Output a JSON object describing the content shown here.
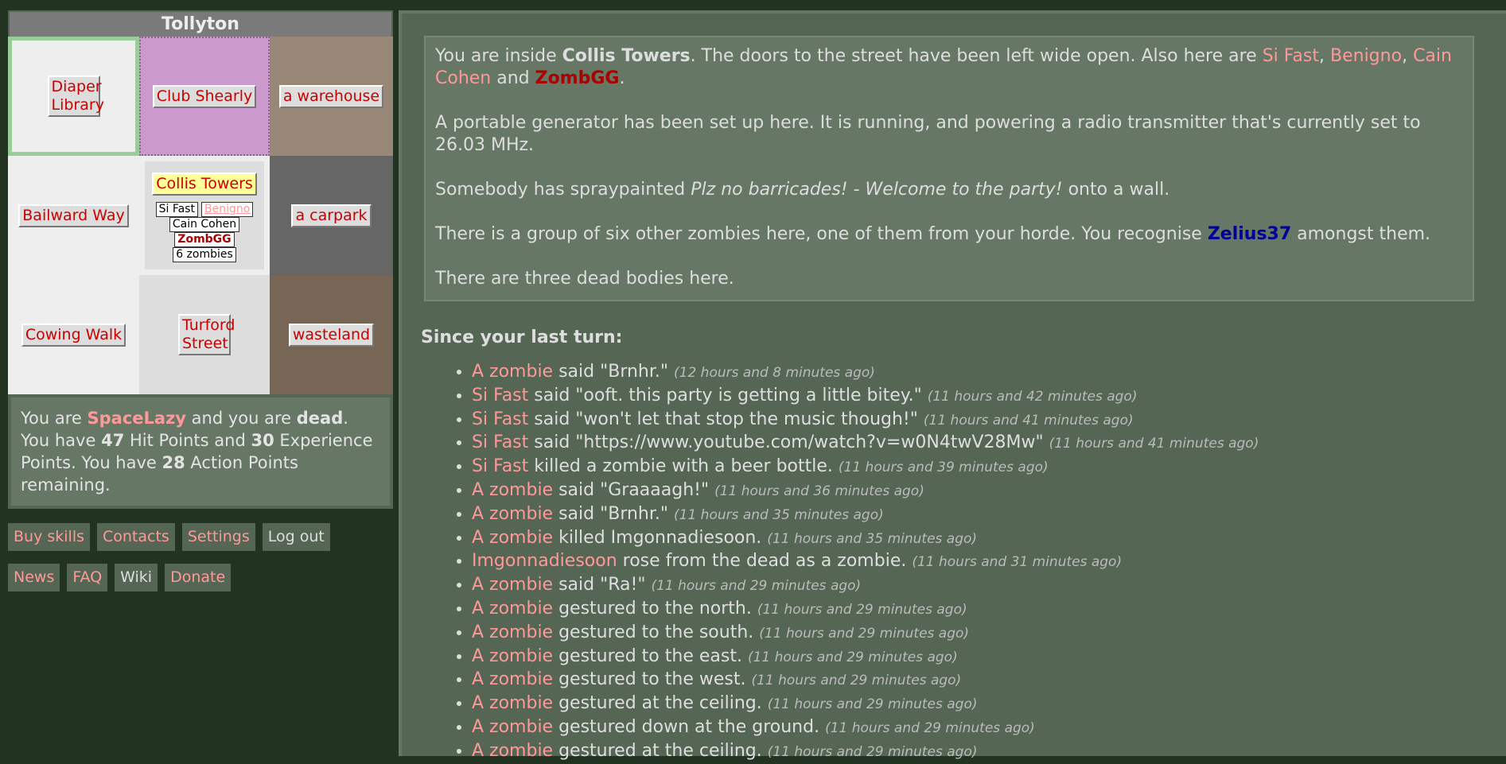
{
  "suburb_name": "Tollyton",
  "map": {
    "cells": [
      {
        "label": "Diaper Library"
      },
      {
        "label": "Club Shearly"
      },
      {
        "label": "a warehouse"
      },
      {
        "label": "Bailward Way"
      },
      {
        "label": "Collis Towers"
      },
      {
        "label": "a carpark"
      },
      {
        "label": "Cowing Walk"
      },
      {
        "label": "Turford Street"
      },
      {
        "label": "wasteland"
      }
    ],
    "occupants": [
      "Si Fast",
      "Benigno",
      "Cain Cohen",
      "ZombGG"
    ],
    "zombie_count": "6 zombies"
  },
  "status": {
    "t1": "You are ",
    "name": "SpaceLazy",
    "t2": " and you are ",
    "state": "dead",
    "t3": ". You have ",
    "hp": "47",
    "t4": " Hit Points and ",
    "xp": "30",
    "t5": " Experience Points. You have ",
    "ap": "28",
    "t6": " Action Points remaining."
  },
  "links_row1": [
    "Buy skills",
    "Contacts",
    "Settings",
    "Log out"
  ],
  "links_row2": [
    "News",
    "FAQ",
    "Wiki",
    "Donate"
  ],
  "description": {
    "p1": {
      "a": "You are inside ",
      "place": "Collis Towers",
      "b": ". The doors to the street have been left wide open. Also here are ",
      "n1": "Si Fast",
      "c": ", ",
      "n2": "Benigno",
      "d": ", ",
      "n3": "Cain Cohen",
      "e": " and ",
      "n4": "ZombGG",
      "f": "."
    },
    "p2": "A portable generator has been set up here. It is running, and powering a radio transmitter that's currently set to 26.03 MHz.",
    "p3": {
      "a": "Somebody has spraypainted ",
      "graffiti": "Plz no barricades! - Welcome to the party!",
      "b": " onto a wall."
    },
    "p4": {
      "a": "There is a group of six other zombies here, one of them from your horde. You recognise ",
      "name": "Zelius37",
      "b": " amongst them."
    },
    "p5": "There are three dead bodies here."
  },
  "since_heading": "Since your last turn:",
  "events": [
    {
      "actor": "A zombie",
      "text": " said \"Brnhr.\" ",
      "ago": "(12 hours and 8 minutes ago)"
    },
    {
      "actor": "Si Fast",
      "text": " said \"ooft. this party is getting a little bitey.\" ",
      "ago": "(11 hours and 42 minutes ago)"
    },
    {
      "actor": "Si Fast",
      "text": " said \"won't let that stop the music though!\" ",
      "ago": "(11 hours and 41 minutes ago)"
    },
    {
      "actor": "Si Fast",
      "text": " said \"https://www.youtube.com/watch?v=w0N4twV28Mw\" ",
      "ago": "(11 hours and 41 minutes ago)"
    },
    {
      "actor": "Si Fast",
      "text": " killed a zombie with a beer bottle. ",
      "ago": "(11 hours and 39 minutes ago)"
    },
    {
      "actor": "A zombie",
      "text": " said \"Graaaagh!\" ",
      "ago": "(11 hours and 36 minutes ago)"
    },
    {
      "actor": "A zombie",
      "text": " said \"Brnhr.\" ",
      "ago": "(11 hours and 35 minutes ago)"
    },
    {
      "actor": "A zombie",
      "text": " killed Imgonnadiesoon. ",
      "ago": "(11 hours and 35 minutes ago)"
    },
    {
      "actor": "Imgonnadiesoon",
      "text": " rose from the dead as a zombie. ",
      "ago": "(11 hours and 31 minutes ago)"
    },
    {
      "actor": "A zombie",
      "text": " said \"Ra!\" ",
      "ago": "(11 hours and 29 minutes ago)"
    },
    {
      "actor": "A zombie",
      "text": " gestured to the north. ",
      "ago": "(11 hours and 29 minutes ago)"
    },
    {
      "actor": "A zombie",
      "text": " gestured to the south. ",
      "ago": "(11 hours and 29 minutes ago)"
    },
    {
      "actor": "A zombie",
      "text": " gestured to the east. ",
      "ago": "(11 hours and 29 minutes ago)"
    },
    {
      "actor": "A zombie",
      "text": " gestured to the west. ",
      "ago": "(11 hours and 29 minutes ago)"
    },
    {
      "actor": "A zombie",
      "text": " gestured at the ceiling. ",
      "ago": "(11 hours and 29 minutes ago)"
    },
    {
      "actor": "A zombie",
      "text": " gestured down at the ground. ",
      "ago": "(11 hours and 29 minutes ago)"
    },
    {
      "actor": "A zombie",
      "text": " gestured at the ceiling. ",
      "ago": "(11 hours and 29 minutes ago)"
    }
  ]
}
